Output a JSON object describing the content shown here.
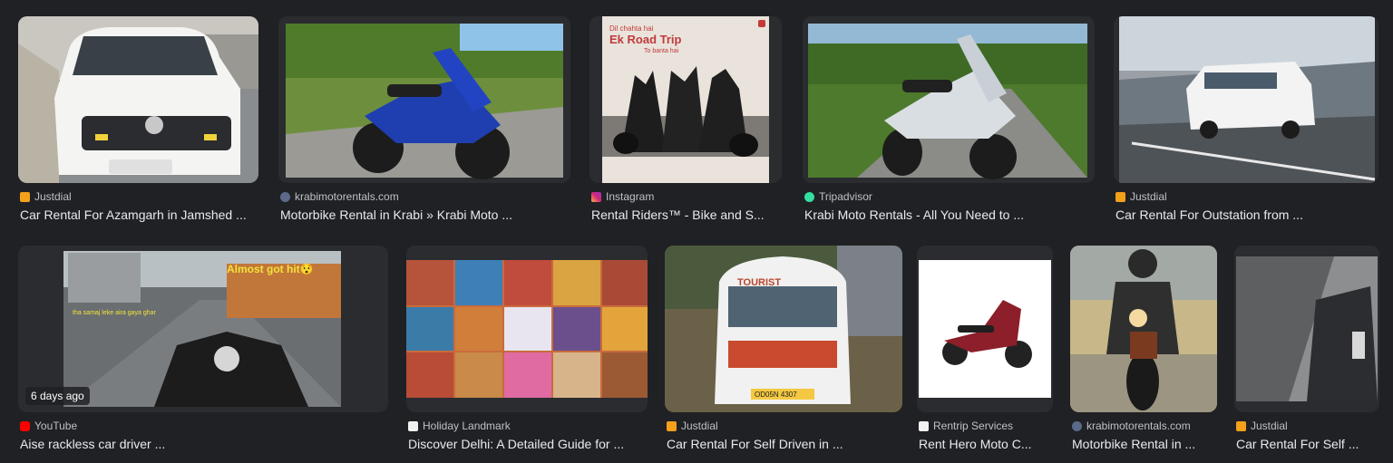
{
  "results_row1": [
    {
      "source": "Justdial",
      "title": "Car Rental For Azamgarh in Jamshed ...",
      "favicon": "justdial-favicon"
    },
    {
      "source": "krabimotorentals.com",
      "title": "Motorbike Rental in Krabi » Krabi Moto ...",
      "favicon": "krabi-favicon"
    },
    {
      "source": "Instagram",
      "title": "Rental Riders™ - Bike and S...",
      "favicon": "instagram-favicon",
      "image_text": {
        "line1": "Dil chahta hai",
        "line2": "Ek Road Trip",
        "line3": "To banta hai"
      }
    },
    {
      "source": "Tripadvisor",
      "title": "Krabi Moto Rentals - All You Need to ...",
      "favicon": "tripadvisor-favicon"
    },
    {
      "source": "Justdial",
      "title": "Car Rental For Outstation from ...",
      "favicon": "justdial-favicon"
    }
  ],
  "results_row2": [
    {
      "source": "YouTube",
      "title": "Aise rackless car driver ...",
      "favicon": "youtube-favicon",
      "badge": "6 days ago",
      "image_text": {
        "caption": "Almost got hit😯",
        "side": "tha samaj leke aira gaya ghar"
      }
    },
    {
      "source": "Holiday Landmark",
      "title": "Discover Delhi: A Detailed Guide for ...",
      "favicon": "holiday-favicon"
    },
    {
      "source": "Justdial",
      "title": "Car Rental For Self Driven in ...",
      "favicon": "justdial-favicon",
      "image_text": {
        "sign": "TOURIST",
        "plate": "OD05N 4307"
      }
    },
    {
      "source": "Rentrip Services",
      "title": "Rent Hero Moto C...",
      "favicon": "rentrip-favicon"
    },
    {
      "source": "krabimotorentals.com",
      "title": "Motorbike Rental in ...",
      "favicon": "krabi-favicon"
    },
    {
      "source": "Justdial",
      "title": "Car Rental For Self ...",
      "favicon": "justdial-favicon"
    }
  ],
  "colors": {
    "background": "#202124",
    "source_text": "#bdc1c6",
    "title_text": "#e8eaed",
    "justdial": "#f3a01b",
    "youtube": "#ff0000",
    "tripadvisor": "#34e0a1",
    "instagram": "#d62976"
  }
}
